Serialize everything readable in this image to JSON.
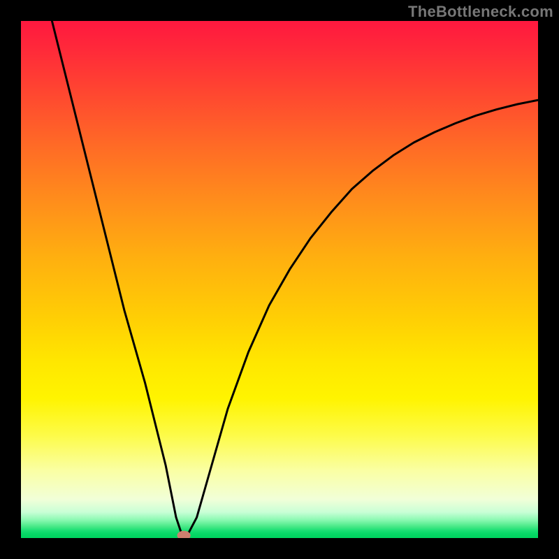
{
  "watermark": "TheBottleneck.com",
  "chart_data": {
    "type": "line",
    "title": "",
    "xlabel": "",
    "ylabel": "",
    "xlim": [
      0,
      100
    ],
    "ylim": [
      0,
      100
    ],
    "grid": false,
    "legend": false,
    "background_gradient": {
      "orientation": "vertical",
      "stops": [
        {
          "pos": 0,
          "color": "#ff183f"
        },
        {
          "pos": 50,
          "color": "#ffc008"
        },
        {
          "pos": 80,
          "color": "#fdfb47"
        },
        {
          "pos": 100,
          "color": "#00d45f"
        }
      ]
    },
    "series": [
      {
        "name": "bottleneck-curve",
        "color": "#000000",
        "x": [
          6,
          8,
          10,
          12,
          14,
          16,
          18,
          20,
          22,
          24,
          26,
          28,
          29,
          30,
          31,
          32,
          34,
          36,
          38,
          40,
          44,
          48,
          52,
          56,
          60,
          64,
          68,
          72,
          76,
          80,
          84,
          88,
          92,
          96,
          100
        ],
        "y": [
          100,
          92,
          84,
          76,
          68,
          60,
          52,
          44,
          37,
          30,
          22,
          14,
          9,
          4,
          1,
          0.2,
          4,
          11,
          18,
          25,
          36,
          45,
          52,
          58,
          63,
          67.5,
          71,
          74,
          76.5,
          78.5,
          80.2,
          81.7,
          82.9,
          83.9,
          84.7
        ]
      }
    ],
    "markers": [
      {
        "name": "optimal-point",
        "x": 31.5,
        "y": 0.5,
        "color": "#ce7f6f",
        "rx": 1.3,
        "ry": 0.9
      }
    ]
  }
}
